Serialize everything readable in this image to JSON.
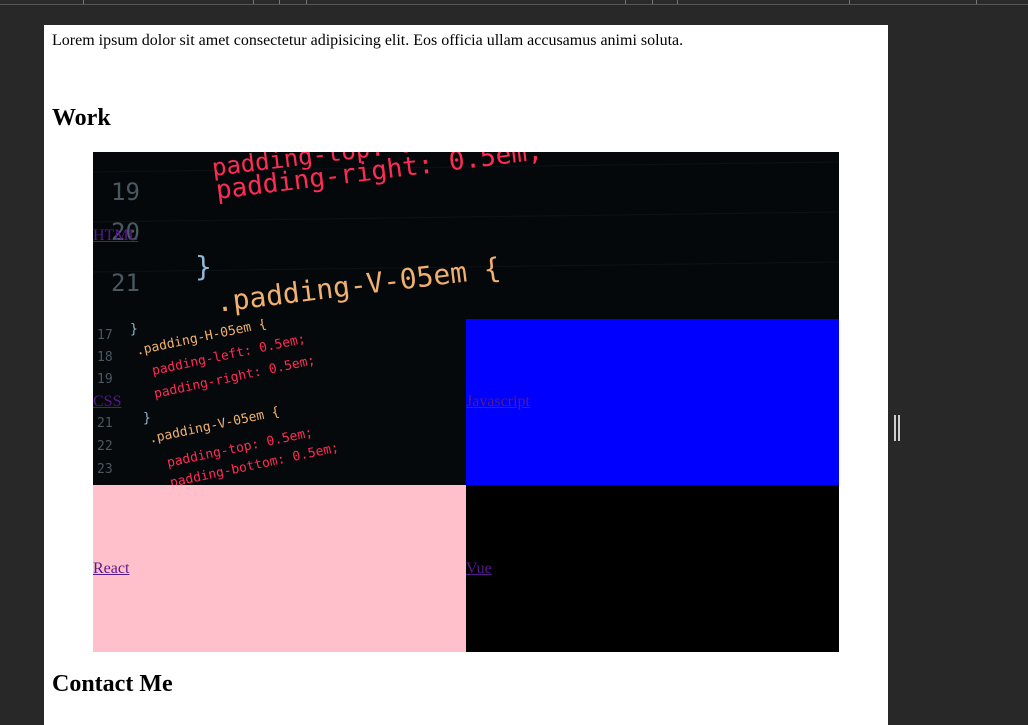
{
  "intro_text": "Lorem ipsum dolor sit amet consectetur adipisicing elit. Eos officia ullam accusamus animi soluta.",
  "work_heading": "Work",
  "contact_heading": "Contact Me",
  "tiles": [
    {
      "label": "HTML",
      "background": "code-image"
    },
    {
      "label": "CSS",
      "background": "code-image"
    },
    {
      "label": "Javascript",
      "background": "#0000ff"
    },
    {
      "label": "React",
      "background": "#ffc0cb"
    },
    {
      "label": "Vue",
      "background": "#000000"
    }
  ],
  "html_code_lines": [
    {
      "line_no": "19",
      "code": "padding-right: 0.5em;"
    },
    {
      "line_no": "20",
      "code": "}"
    },
    {
      "line_no": "21",
      "code": ".padding-V-05em {"
    },
    {
      "line_no": "",
      "code": "padding-top: 0.5em;"
    }
  ],
  "css_code_lines": [
    {
      "line_no": "17",
      "code": "}"
    },
    {
      "line_no": "",
      "code": ".padding-H-05em {"
    },
    {
      "line_no": "18",
      "code": "padding-left: 0.5em;"
    },
    {
      "line_no": "19",
      "code": "padding-right: 0.5em;"
    },
    {
      "line_no": "21",
      "code": "}"
    },
    {
      "line_no": "",
      "code": ".padding-V-05em {"
    },
    {
      "line_no": "22",
      "code": "padding-top: 0.5em;"
    },
    {
      "line_no": "23",
      "code": "padding-bottom: 0.5em;"
    }
  ],
  "colors": {
    "code_number": "#4a5861",
    "code_selector": "#f0b070",
    "code_property": "#ff2b55",
    "code_value": "#ffc05a",
    "code_unit": "#a77cff",
    "link": "#551a8b"
  },
  "handle_icon": "resize-handle-icon"
}
